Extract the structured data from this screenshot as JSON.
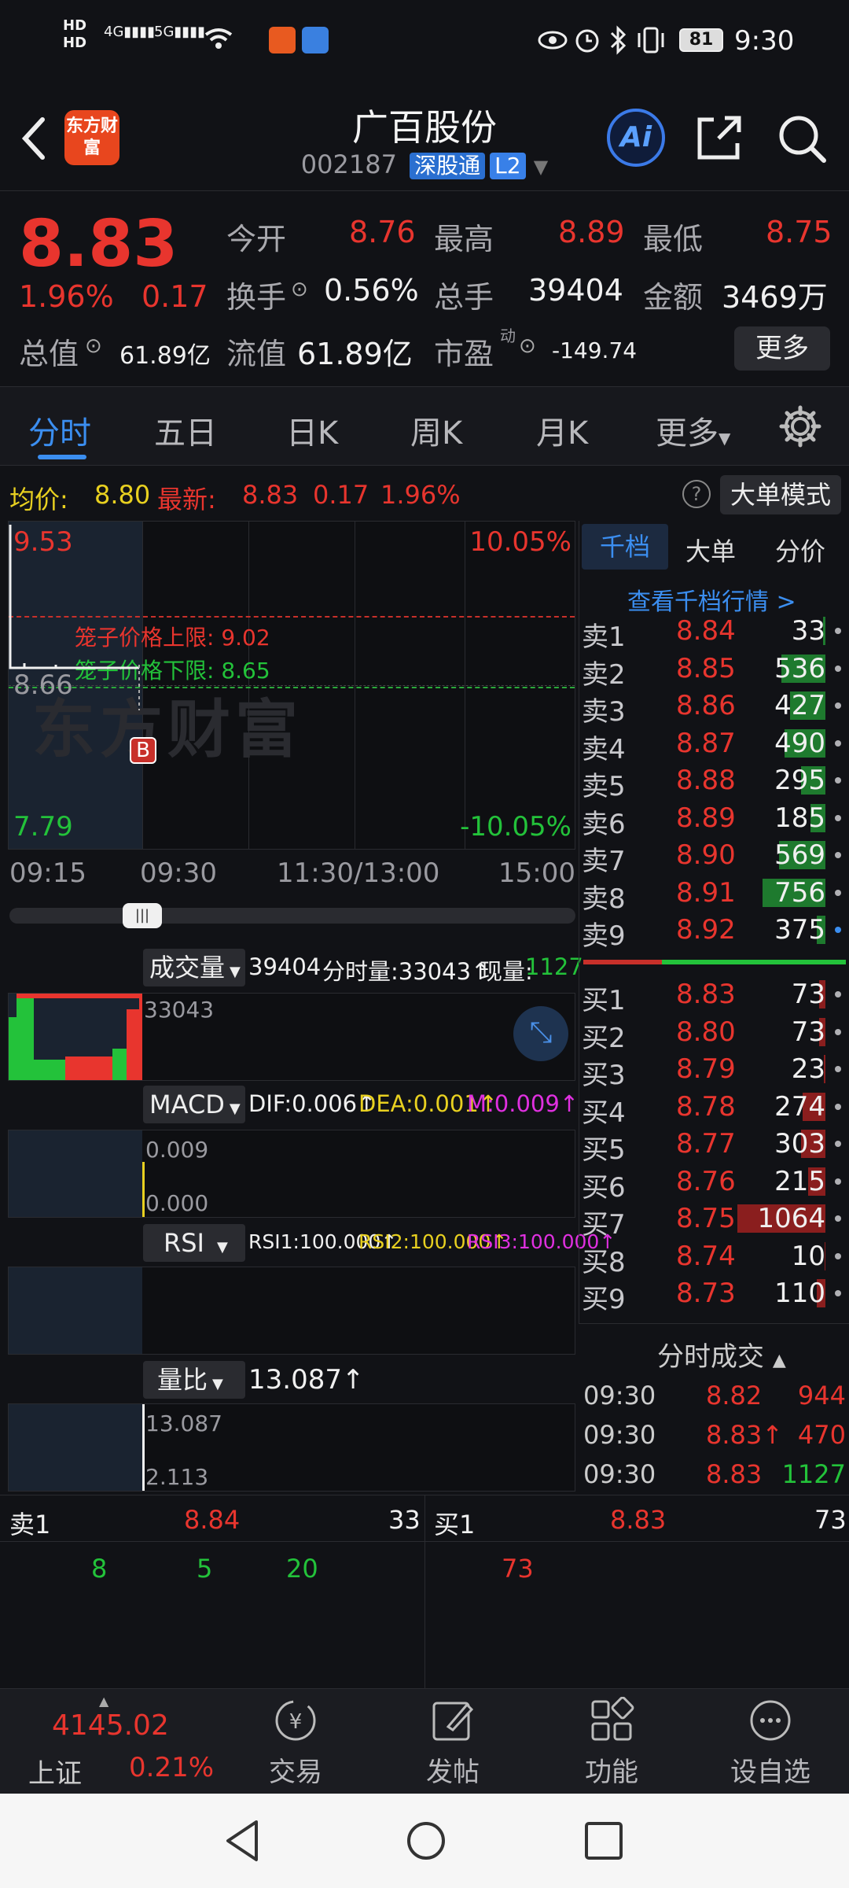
{
  "status": {
    "left_icons": [
      "HD1",
      "HD2",
      "4G",
      "5G",
      "wifi-icon",
      "app-notif-icon",
      "app-notif-icon-2"
    ],
    "battery": "81",
    "time": "9:30"
  },
  "header": {
    "logo_text": "东方财富",
    "title": "广百股份",
    "code": "002187",
    "tag1": "深股通",
    "tag2": "L2",
    "ai_label": "Ai"
  },
  "quote": {
    "price": "8.83",
    "pct": "1.96%",
    "chg": "0.17",
    "open_label": "今开",
    "open": "8.76",
    "high_label": "最高",
    "high": "8.89",
    "low_label": "最低",
    "low": "8.75",
    "turnover_label": "换手",
    "turnover": "0.56%",
    "volume_label": "总手",
    "volume": "39404",
    "amount_label": "金额",
    "amount": "3469万",
    "mktcap_label": "总值",
    "mktcap": "61.89亿",
    "float_label": "流值",
    "float": "61.89亿",
    "pe_label": "市盈",
    "pe_sup": "动",
    "pe": "-149.74",
    "more_button": "更多"
  },
  "tabs": [
    "分时",
    "五日",
    "日K",
    "周K",
    "月K",
    "更多"
  ],
  "avg_row": {
    "avg_label": "均价:",
    "avg": "8.80",
    "latest_label": "最新:",
    "latest": "8.83",
    "chg": "0.17",
    "pct": "1.96%",
    "mode_button": "大单模式"
  },
  "chart": {
    "y_top": "9.53",
    "y_mid": "8.66",
    "y_bottom": "7.79",
    "pct_top": "10.05%",
    "pct_bottom": "-10.05%",
    "upper_limit": "笼子价格上限: 9.02",
    "lower_limit": "笼子价格下限: 8.65",
    "watermark": "东方财富",
    "marker": "B",
    "times": [
      "09:15",
      "09:30",
      "11:30/13:00",
      "15:00"
    ]
  },
  "volume": {
    "select": "成交量",
    "total": "39404",
    "tick_label": "分时量:33043↑",
    "now_label": "现量:",
    "now": "1127",
    "axis": "33043"
  },
  "macd": {
    "select": "MACD",
    "dif": "DIF:0.006↑",
    "dea": "DEA:0.001↑",
    "m": "M:0.009↑",
    "axis_top": "0.009",
    "axis_bottom": "0.000"
  },
  "rsi": {
    "select": "RSI",
    "rsi1": "RSI1:100.000↑",
    "rsi2": "RSI2:100.000↑",
    "rsi3": "RSI3:100.000↑"
  },
  "lb": {
    "select": "量比",
    "value": "13.087↑",
    "axis_top": "13.087",
    "axis_bottom": "2.113"
  },
  "orderbook": {
    "tabs": [
      "千档",
      "大单",
      "分价"
    ],
    "link": "查看千档行情 >",
    "sells": [
      {
        "label": "卖9",
        "price": "8.92",
        "vol": "375",
        "bar": 0.1
      },
      {
        "label": "卖8",
        "price": "8.91",
        "vol": "756",
        "bar": 0.71
      },
      {
        "label": "卖7",
        "price": "8.90",
        "vol": "569",
        "bar": 0.53
      },
      {
        "label": "卖6",
        "price": "8.89",
        "vol": "185",
        "bar": 0.17
      },
      {
        "label": "卖5",
        "price": "8.88",
        "vol": "295",
        "bar": 0.28
      },
      {
        "label": "卖4",
        "price": "8.87",
        "vol": "490",
        "bar": 0.46
      },
      {
        "label": "卖3",
        "price": "8.86",
        "vol": "427",
        "bar": 0.4
      },
      {
        "label": "卖2",
        "price": "8.85",
        "vol": "536",
        "bar": 0.5
      },
      {
        "label": "卖1",
        "price": "8.84",
        "vol": "33",
        "bar": 0.03
      }
    ],
    "buys": [
      {
        "label": "买1",
        "price": "8.83",
        "vol": "73",
        "bar": 0.07
      },
      {
        "label": "买2",
        "price": "8.80",
        "vol": "73",
        "bar": 0.07
      },
      {
        "label": "买3",
        "price": "8.79",
        "vol": "23",
        "bar": 0.02
      },
      {
        "label": "买4",
        "price": "8.78",
        "vol": "274",
        "bar": 0.26
      },
      {
        "label": "买5",
        "price": "8.77",
        "vol": "303",
        "bar": 0.28
      },
      {
        "label": "买6",
        "price": "8.76",
        "vol": "215",
        "bar": 0.2
      },
      {
        "label": "买7",
        "price": "8.75",
        "vol": "1064",
        "bar": 1.0
      },
      {
        "label": "买8",
        "price": "8.74",
        "vol": "10",
        "bar": 0.01
      },
      {
        "label": "买9",
        "price": "8.73",
        "vol": "110",
        "bar": 0.1
      }
    ]
  },
  "ticks": {
    "header": "分时成交",
    "rows": [
      {
        "time": "09:30",
        "price": "8.82",
        "vol": "944"
      },
      {
        "time": "09:30",
        "price": "8.83↑",
        "vol": "470"
      },
      {
        "time": "09:30",
        "price": "8.83",
        "vol": "1127"
      }
    ]
  },
  "queue": {
    "sell_label": "卖1",
    "sell_price": "8.84",
    "sell_vol": "33",
    "buy_label": "买1",
    "buy_price": "8.83",
    "buy_vol": "73",
    "sell_orders": [
      "8",
      "5",
      "20"
    ],
    "buy_orders": [
      "73"
    ]
  },
  "bottom_nav": {
    "index_value": "4145.02",
    "index_name": "上证",
    "index_pct": "0.21%",
    "items": [
      "交易",
      "发帖",
      "功能",
      "设自选"
    ]
  }
}
